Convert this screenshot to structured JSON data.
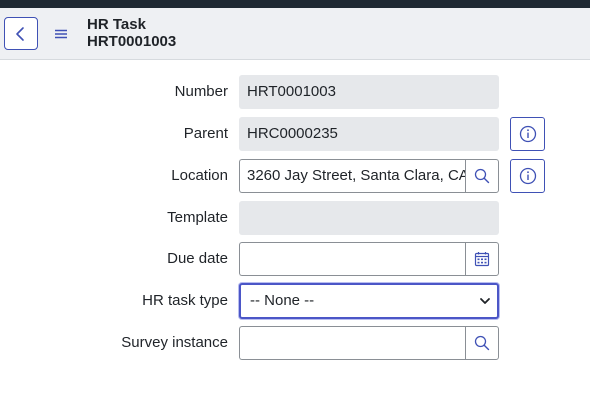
{
  "header": {
    "back_icon": "chevron-left-icon",
    "menu_icon": "hamburger-menu-icon",
    "title": "HR Task",
    "subtitle": "HRT0001003"
  },
  "form": {
    "number": {
      "label": "Number",
      "value": "HRT0001003"
    },
    "parent": {
      "label": "Parent",
      "value": "HRC0000235",
      "info_icon": "info-icon"
    },
    "location": {
      "label": "Location",
      "value": "3260 Jay Street, Santa Clara, CA",
      "lookup_icon": "search-icon",
      "info_icon": "info-icon"
    },
    "template": {
      "label": "Template",
      "value": ""
    },
    "due_date": {
      "label": "Due date",
      "value": "",
      "calendar_icon": "calendar-icon"
    },
    "hr_task_type": {
      "label": "HR task type",
      "selected": "-- None --"
    },
    "survey_instance": {
      "label": "Survey instance",
      "value": "",
      "lookup_icon": "search-icon"
    }
  },
  "colors": {
    "accent": "#3f51b5",
    "readonly_bg": "#e6e8eb",
    "header_bg": "#eef0f3",
    "top_strip": "#1f2933"
  }
}
